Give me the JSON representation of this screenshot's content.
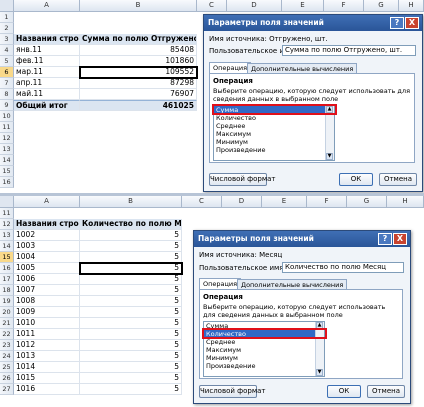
{
  "columns": [
    "A",
    "B",
    "C",
    "D",
    "E",
    "F",
    "G",
    "H"
  ],
  "top": {
    "row_numbers": [
      "1",
      "2",
      "3",
      "4",
      "5",
      "6",
      "7",
      "8",
      "9",
      "10",
      "11",
      "12",
      "13",
      "14",
      "15",
      "16"
    ],
    "selected_row": "6",
    "header": {
      "row_labels": "Названия строк",
      "values": "Сумма по полю Отгружено, шт."
    },
    "rows": [
      {
        "label": "янв.11",
        "value": "85408"
      },
      {
        "label": "фев.11",
        "value": "101860"
      },
      {
        "label": "мар.11",
        "value": "109552"
      },
      {
        "label": "апр.11",
        "value": "87298"
      },
      {
        "label": "май.11",
        "value": "76907"
      }
    ],
    "total": {
      "label": "Общий итог",
      "value": "461025"
    },
    "dialog": {
      "title": "Параметры поля значений",
      "help": "?",
      "close": "X",
      "source_label": "Имя источника:",
      "source_value": "Отгружено, шт.",
      "custom_label": "Пользовательское имя:",
      "custom_value": "Сумма по полю Отгружено, шт.",
      "tab_operation": "Операция",
      "tab_extra": "Дополнительные вычисления",
      "section": "Операция",
      "description": "Выберите операцию, которую следует использовать для сведения данных в выбранном поле",
      "items": [
        "Сумма",
        "Количество",
        "Среднее",
        "Максимум",
        "Минимум",
        "Произведение"
      ],
      "selected": "Сумма",
      "number_format": "Числовой формат",
      "ok": "ОК",
      "cancel": "Отмена"
    }
  },
  "bottom": {
    "row_numbers": [
      "11",
      "12",
      "13",
      "14",
      "15",
      "16",
      "17",
      "18",
      "19",
      "20",
      "21",
      "22",
      "23",
      "24",
      "25",
      "26",
      "27"
    ],
    "selected_row": "15",
    "header": {
      "row_labels": "Названия строк",
      "values": "Количество по полю Месяц"
    },
    "rows": [
      {
        "label": "1002",
        "value": "5"
      },
      {
        "label": "1003",
        "value": "5"
      },
      {
        "label": "1004",
        "value": "5"
      },
      {
        "label": "1005",
        "value": "5"
      },
      {
        "label": "1006",
        "value": "5"
      },
      {
        "label": "1007",
        "value": "5"
      },
      {
        "label": "1008",
        "value": "5"
      },
      {
        "label": "1009",
        "value": "5"
      },
      {
        "label": "1010",
        "value": "5"
      },
      {
        "label": "1011",
        "value": "5"
      },
      {
        "label": "1012",
        "value": "5"
      },
      {
        "label": "1013",
        "value": "5"
      },
      {
        "label": "1014",
        "value": "5"
      },
      {
        "label": "1015",
        "value": "5"
      },
      {
        "label": "1016",
        "value": "5"
      }
    ],
    "dialog": {
      "title": "Параметры поля значений",
      "help": "?",
      "close": "X",
      "source_label": "Имя источника:",
      "source_value": "Месяц",
      "custom_label": "Пользовательское имя:",
      "custom_value": "Количество по полю Месяц",
      "tab_operation": "Операция",
      "tab_extra": "Дополнительные вычисления",
      "section": "Операция",
      "description": "Выберите операцию, которую следует использовать для сведения данных в выбранном поле",
      "items": [
        "Сумма",
        "Количество",
        "Среднее",
        "Максимум",
        "Минимум",
        "Произведение"
      ],
      "selected": "Количество",
      "number_format": "Числовой формат",
      "ok": "ОК",
      "cancel": "Отмена"
    }
  }
}
